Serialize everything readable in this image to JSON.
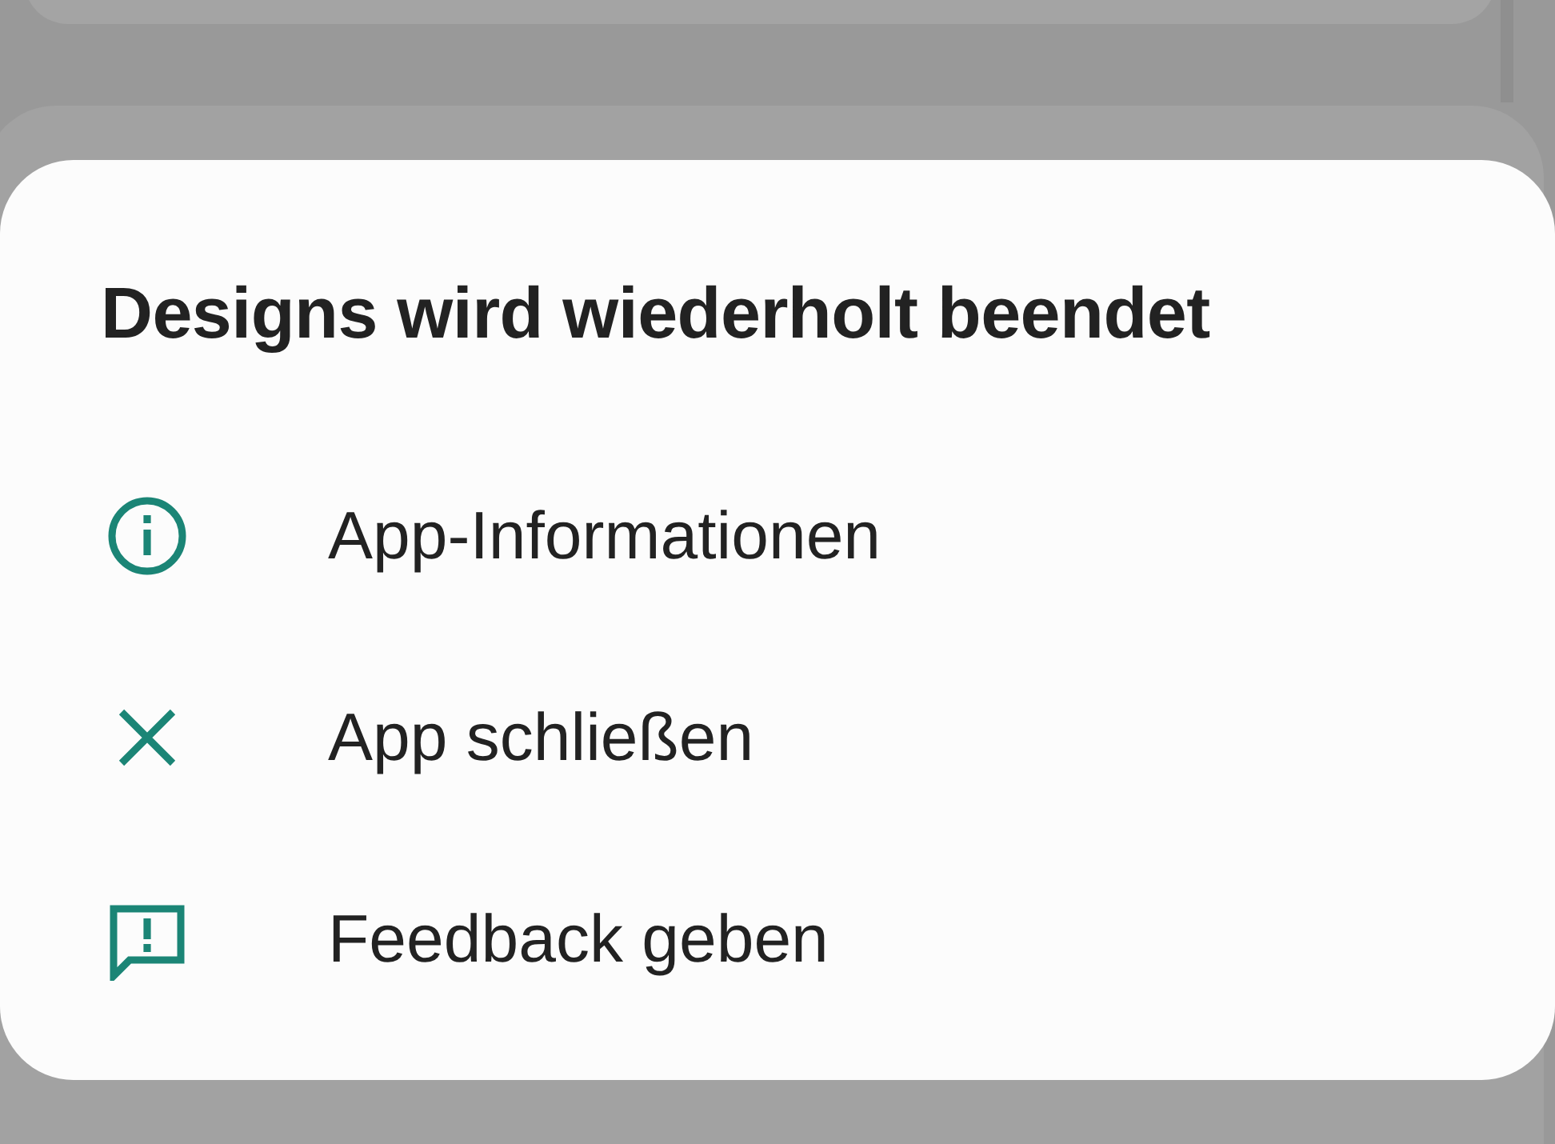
{
  "dialog": {
    "title": "Designs wird wiederholt beendet",
    "actions": [
      {
        "kind": "info",
        "label": "App-Informationen"
      },
      {
        "kind": "close",
        "label": "App schließen"
      },
      {
        "kind": "feedback",
        "label": "Feedback geben"
      }
    ]
  }
}
